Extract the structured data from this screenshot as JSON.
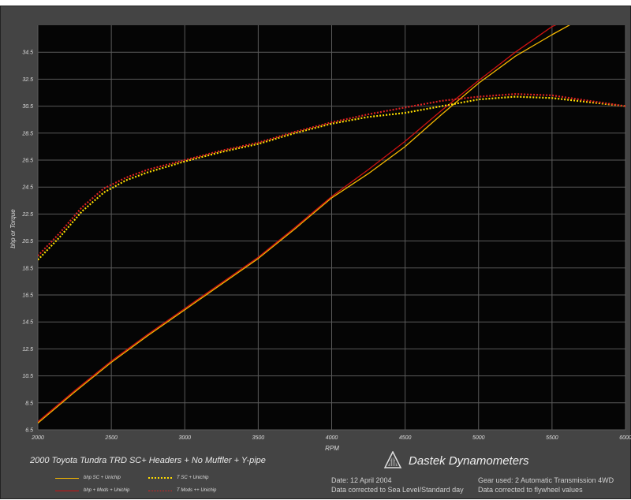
{
  "chart_data": {
    "type": "line",
    "title": "2000 Toyota Tundra TRD SC+ Headers + No Muffler + Y-pipe",
    "xlabel": "RPM",
    "ylabel": "bhp or Torque",
    "xlim": [
      2000,
      6000
    ],
    "ylim": [
      6.5,
      36.5
    ],
    "x_ticks": [
      "2000",
      "2500",
      "3000",
      "3500",
      "4000",
      "4500",
      "5000",
      "5500",
      "6000"
    ],
    "y_ticks": [
      "6.5",
      "8.5",
      "10.5",
      "12.5",
      "14.5",
      "16.5",
      "18.5",
      "20.5",
      "22.5",
      "24.5",
      "26.5",
      "28.5",
      "30.5",
      "32.5",
      "34.5"
    ],
    "grid": true,
    "background": "#050505",
    "series": [
      {
        "name": "bhp SC + Unichip",
        "color": "#f5b800",
        "style": "solid",
        "x": [
          2000,
          2250,
          2500,
          2750,
          3000,
          3250,
          3500,
          3750,
          4000,
          4250,
          4500,
          4750,
          5000,
          5250,
          5500,
          5750,
          6000
        ],
        "values": [
          7.0,
          9.3,
          11.5,
          13.5,
          15.4,
          17.3,
          19.2,
          21.4,
          23.7,
          25.5,
          27.5,
          29.9,
          32.2,
          34.2,
          35.8,
          37.3,
          38.3
        ]
      },
      {
        "name": "bhp + Mods + Unichip",
        "color": "#cc1111",
        "style": "solid",
        "x": [
          2000,
          2250,
          2500,
          2750,
          3000,
          3250,
          3500,
          3750,
          4000,
          4250,
          4500,
          4750,
          5000,
          5250,
          5500,
          5750,
          6000
        ],
        "values": [
          7.1,
          9.4,
          11.6,
          13.6,
          15.5,
          17.4,
          19.3,
          21.5,
          23.8,
          25.8,
          27.9,
          30.2,
          32.4,
          34.5,
          36.4,
          37.6,
          38.3
        ]
      },
      {
        "name": "T SC + Unichip",
        "color": "#ffdd00",
        "style": "dotted",
        "x": [
          2000,
          2150,
          2300,
          2450,
          2600,
          2750,
          3000,
          3250,
          3500,
          3750,
          4000,
          4250,
          4500,
          4750,
          5000,
          5250,
          5500,
          5750,
          6000
        ],
        "values": [
          19.1,
          20.8,
          22.7,
          24.1,
          25.0,
          25.6,
          26.4,
          27.1,
          27.7,
          28.5,
          29.2,
          29.7,
          30.0,
          30.5,
          31.0,
          31.2,
          31.1,
          30.8,
          30.5
        ]
      },
      {
        "name": "T Mods ++ Unichip",
        "color": "#dd2222",
        "style": "dotted",
        "x": [
          2000,
          2150,
          2300,
          2450,
          2600,
          2750,
          3000,
          3250,
          3500,
          3750,
          4000,
          4250,
          4500,
          4750,
          5000,
          5250,
          5500,
          5750,
          6000
        ],
        "values": [
          19.4,
          21.1,
          23.0,
          24.4,
          25.2,
          25.8,
          26.5,
          27.2,
          27.8,
          28.6,
          29.3,
          29.9,
          30.4,
          30.9,
          31.2,
          31.4,
          31.3,
          30.9,
          30.5
        ]
      }
    ]
  },
  "brand": "Dastek Dynamometers",
  "legend": {
    "bhp_sc": "bhp SC + Unichip",
    "t_sc": "T SC + Unichip",
    "bhp_mods": "bhp + Mods + Unichip",
    "t_mods": "T Mods ++ Unichip"
  },
  "info": {
    "date": "Date: 12 April 2004",
    "corrected_sea": "Data corrected to Sea Level/Standard day",
    "gear": "Gear used: 2 Automatic Transmission 4WD",
    "corrected_flywheel": "Data corrected to flywheel values"
  },
  "colors": {
    "bhp_sc": "#f5b800",
    "bhp_mods": "#cc1111",
    "t_sc": "#ffdd00",
    "t_mods": "#dd2222"
  }
}
